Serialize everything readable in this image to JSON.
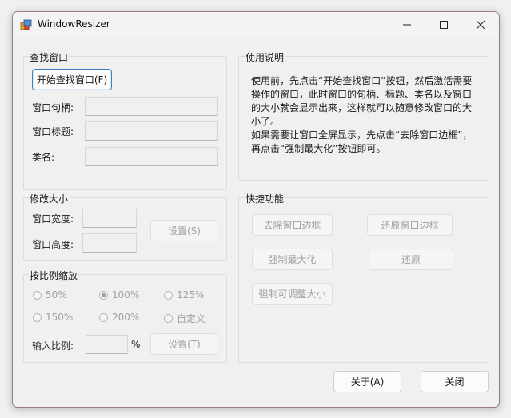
{
  "window": {
    "title": "WindowResizer"
  },
  "find_group": {
    "title": "查找窗口",
    "start_button": "开始查找窗口(F)",
    "handle_label": "窗口句柄:",
    "title_label": "窗口标题:",
    "class_label": "类名:",
    "handle_value": "",
    "title_value": "",
    "class_value": ""
  },
  "resize_group": {
    "title": "修改大小",
    "width_label": "窗口宽度:",
    "height_label": "窗口高度:",
    "width_value": "",
    "height_value": "",
    "set_button": "设置(S)"
  },
  "scale_group": {
    "title": "按比例缩放",
    "options": [
      "50%",
      "100%",
      "125%",
      "150%",
      "200%",
      "自定义"
    ],
    "selected": "100%",
    "ratio_label": "输入比例:",
    "ratio_value": "",
    "percent_sign": "%",
    "set_button": "设置(T)"
  },
  "usage_group": {
    "title": "使用说明",
    "paragraph1": "使用前，先点击“开始查找窗口”按钮，然后激活需要操作的窗口，此时窗口的句柄、标题、类名以及窗口的大小就会显示出来，这样就可以随意修改窗口的大小了。",
    "paragraph2": "如果需要让窗口全屏显示，先点击“去除窗口边框”，再点击“强制最大化”按钮即可。"
  },
  "quick_group": {
    "title": "快捷功能",
    "remove_border": "去除窗口边框",
    "restore_border": "还原窗口边框",
    "force_maximize": "强制最大化",
    "restore": "还原",
    "force_resizable": "强制可调整大小"
  },
  "footer": {
    "about_button": "关于(A)",
    "close_button": "关闭"
  }
}
